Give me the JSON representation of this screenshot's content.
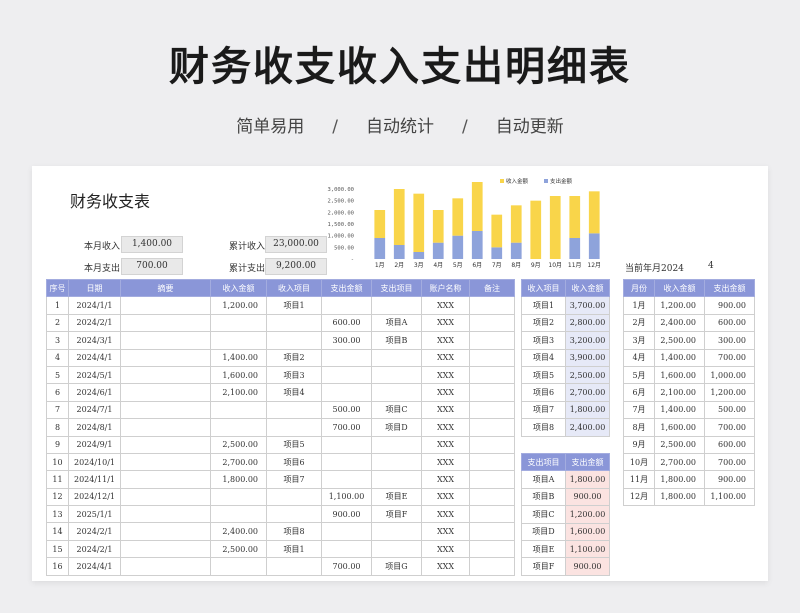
{
  "header": {
    "title": "财务收支收入支出明细表",
    "tags": [
      "简单易用",
      "自动统计",
      "自动更新"
    ],
    "sep": "/"
  },
  "sheet_title": "财务收支表",
  "summary": {
    "month_income_label": "本月收入",
    "month_income": "1,400.00",
    "month_expense_label": "本月支出",
    "month_expense": "700.00",
    "total_income_label": "累计收入",
    "total_income": "23,000.00",
    "total_expense_label": "累计支出",
    "total_expense": "9,200.00"
  },
  "current": {
    "label": "当前年月2024",
    "value": "4"
  },
  "chart_data": {
    "type": "bar",
    "categories": [
      "1月",
      "2月",
      "3月",
      "4月",
      "5月",
      "6月",
      "7月",
      "8月",
      "9月",
      "10月",
      "11月",
      "12月"
    ],
    "series": [
      {
        "name": "收入金额",
        "values": [
          1200,
          2400,
          2500,
          1400,
          1600,
          2100,
          1400,
          1600,
          2500,
          2700,
          1800,
          1800
        ],
        "color": "#f9d54a"
      },
      {
        "name": "支出金额",
        "values": [
          900,
          600,
          300,
          700,
          1000,
          1200,
          500,
          700,
          0,
          0,
          900,
          1100
        ],
        "color": "#8ea3db"
      }
    ],
    "stacked": true,
    "yticks": [
      "3,000.00",
      "2,500.00",
      "2,000.00",
      "1,500.00",
      "1,000.00",
      "500.00",
      "-"
    ],
    "ylim": [
      0,
      3000
    ],
    "legend_position": "top"
  },
  "main_table": {
    "headers": [
      "序号",
      "日期",
      "摘要",
      "收入金额",
      "收入项目",
      "支出金额",
      "支出项目",
      "账户名称",
      "备注"
    ],
    "rows": [
      [
        "1",
        "2024/1/1",
        "",
        "1,200.00",
        "项目1",
        "",
        "",
        "XXX",
        ""
      ],
      [
        "2",
        "2024/2/1",
        "",
        "",
        "",
        "600.00",
        "项目A",
        "XXX",
        ""
      ],
      [
        "3",
        "2024/3/1",
        "",
        "",
        "",
        "300.00",
        "项目B",
        "XXX",
        ""
      ],
      [
        "4",
        "2024/4/1",
        "",
        "1,400.00",
        "项目2",
        "",
        "",
        "XXX",
        ""
      ],
      [
        "5",
        "2024/5/1",
        "",
        "1,600.00",
        "项目3",
        "",
        "",
        "XXX",
        ""
      ],
      [
        "6",
        "2024/6/1",
        "",
        "2,100.00",
        "项目4",
        "",
        "",
        "XXX",
        ""
      ],
      [
        "7",
        "2024/7/1",
        "",
        "",
        "",
        "500.00",
        "项目C",
        "XXX",
        ""
      ],
      [
        "8",
        "2024/8/1",
        "",
        "",
        "",
        "700.00",
        "项目D",
        "XXX",
        ""
      ],
      [
        "9",
        "2024/9/1",
        "",
        "2,500.00",
        "项目5",
        "",
        "",
        "XXX",
        ""
      ],
      [
        "10",
        "2024/10/1",
        "",
        "2,700.00",
        "项目6",
        "",
        "",
        "XXX",
        ""
      ],
      [
        "11",
        "2024/11/1",
        "",
        "1,800.00",
        "项目7",
        "",
        "",
        "XXX",
        ""
      ],
      [
        "12",
        "2024/12/1",
        "",
        "",
        "",
        "1,100.00",
        "项目E",
        "XXX",
        ""
      ],
      [
        "13",
        "2025/1/1",
        "",
        "",
        "",
        "900.00",
        "项目F",
        "XXX",
        ""
      ],
      [
        "14",
        "2024/2/1",
        "",
        "2,400.00",
        "项目8",
        "",
        "",
        "XXX",
        ""
      ],
      [
        "15",
        "2024/2/1",
        "",
        "2,500.00",
        "项目1",
        "",
        "",
        "XXX",
        ""
      ],
      [
        "16",
        "2024/4/1",
        "",
        "",
        "",
        "700.00",
        "项目G",
        "XXX",
        ""
      ]
    ]
  },
  "income_table": {
    "headers": [
      "收入项目",
      "收入金额"
    ],
    "rows": [
      [
        "项目1",
        "3,700.00"
      ],
      [
        "项目2",
        "2,800.00"
      ],
      [
        "项目3",
        "3,200.00"
      ],
      [
        "项目4",
        "3,900.00"
      ],
      [
        "项目5",
        "2,500.00"
      ],
      [
        "项目6",
        "2,700.00"
      ],
      [
        "项目7",
        "1,800.00"
      ],
      [
        "项目8",
        "2,400.00"
      ]
    ]
  },
  "expense_table": {
    "headers": [
      "支出项目",
      "支出金额"
    ],
    "rows": [
      [
        "项目A",
        "1,800.00"
      ],
      [
        "项目B",
        "900.00"
      ],
      [
        "项目C",
        "1,200.00"
      ],
      [
        "项目D",
        "1,600.00"
      ],
      [
        "项目E",
        "1,100.00"
      ],
      [
        "项目F",
        "900.00"
      ]
    ]
  },
  "month_table": {
    "headers": [
      "月份",
      "收入金额",
      "支出金额"
    ],
    "rows": [
      [
        "1月",
        "1,200.00",
        "900.00"
      ],
      [
        "2月",
        "2,400.00",
        "600.00"
      ],
      [
        "3月",
        "2,500.00",
        "300.00"
      ],
      [
        "4月",
        "1,400.00",
        "700.00"
      ],
      [
        "5月",
        "1,600.00",
        "1,000.00"
      ],
      [
        "6月",
        "2,100.00",
        "1,200.00"
      ],
      [
        "7月",
        "1,400.00",
        "500.00"
      ],
      [
        "8月",
        "1,600.00",
        "700.00"
      ],
      [
        "9月",
        "2,500.00",
        "600.00"
      ],
      [
        "10月",
        "2,700.00",
        "700.00"
      ],
      [
        "11月",
        "1,800.00",
        "900.00"
      ],
      [
        "12月",
        "1,800.00",
        "1,100.00"
      ]
    ]
  }
}
